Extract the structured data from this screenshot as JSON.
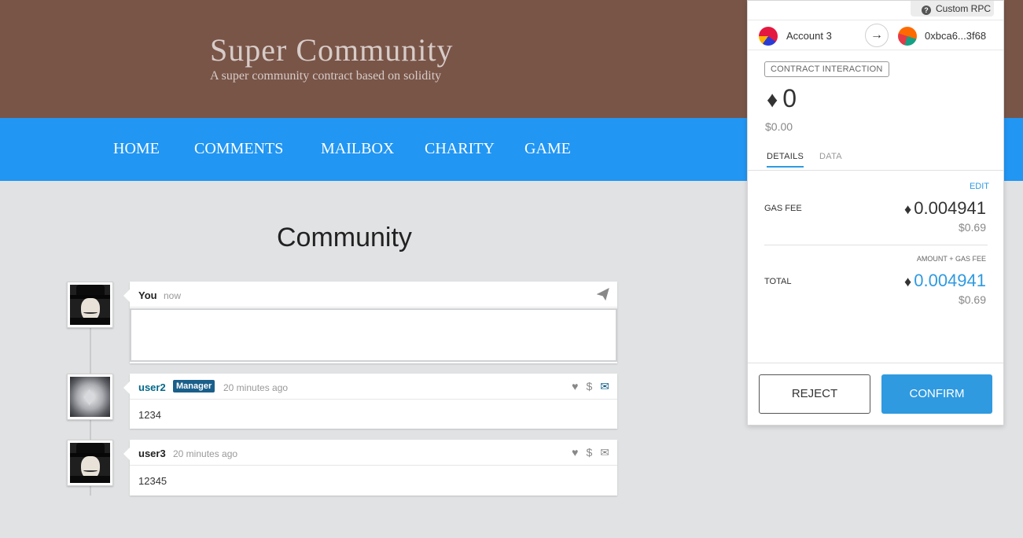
{
  "header": {
    "title": "Super Community",
    "subtitle": "A super community contract based on solidity"
  },
  "nav": {
    "items": [
      "HOME",
      "COMMENTS",
      "MAILBOX",
      "CHARITY",
      "GAME"
    ]
  },
  "main": {
    "title": "Community",
    "compose": {
      "user": "You",
      "time": "now"
    },
    "comments": [
      {
        "user": "user2",
        "badge": "Manager",
        "time": "20 minutes ago",
        "text": "1234"
      },
      {
        "user": "user3",
        "time": "20 minutes ago",
        "text": "12345"
      }
    ]
  },
  "metamask": {
    "network": "Custom RPC",
    "from_account": "Account 3",
    "to_address": "0xbca6...3f68",
    "tx_type": "CONTRACT INTERACTION",
    "amount": "0",
    "amount_fiat": "$0.00",
    "tabs": [
      "DETAILS",
      "DATA"
    ],
    "edit_label": "EDIT",
    "gas_fee_label": "GAS FEE",
    "gas_fee_value": "0.004941",
    "gas_fee_fiat": "$0.69",
    "total_sublabel": "AMOUNT + GAS FEE",
    "total_label": "TOTAL",
    "total_value": "0.004941",
    "total_fiat": "$0.69",
    "reject_label": "REJECT",
    "confirm_label": "CONFIRM",
    "accent_color": "#2f9ae0"
  },
  "icons": {
    "send": "paper-plane-icon",
    "like": "heart-icon",
    "tip": "dollar-icon",
    "message": "envelope-icon",
    "eth": "ethereum-icon"
  }
}
